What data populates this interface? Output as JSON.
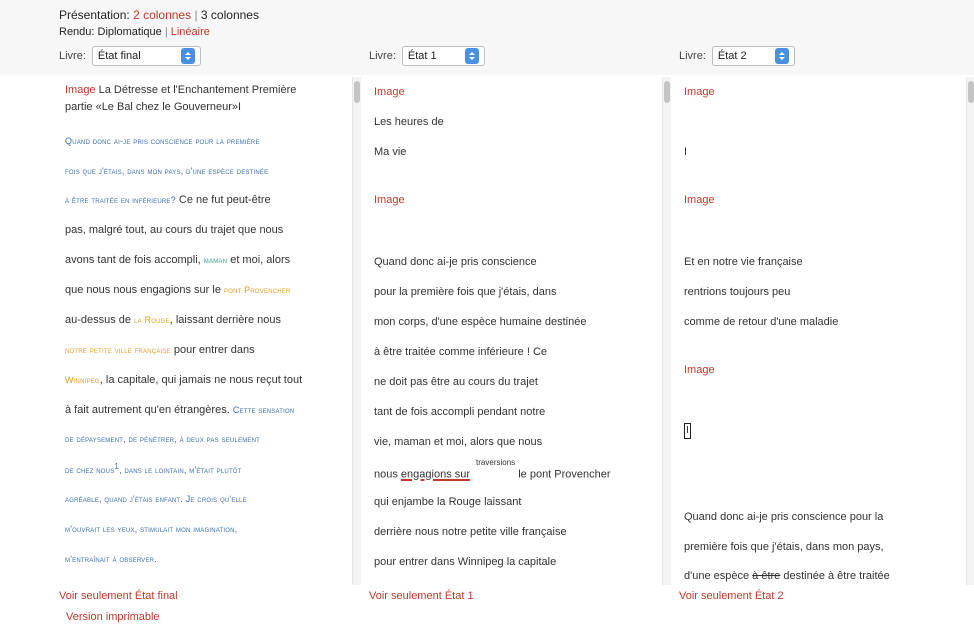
{
  "header": {
    "presentation_label": "Présentation:",
    "presentation_opt1": "2 colonnes",
    "presentation_sep": "|",
    "presentation_opt2": "3 colonnes",
    "rendu_label": "Rendu:",
    "rendu_opt1": "Diplomatique",
    "rendu_sep": "|",
    "rendu_opt2": "Linéaire"
  },
  "selectors": [
    {
      "label": "Livre:",
      "value": "État final"
    },
    {
      "label": "Livre:",
      "value": "État 1"
    },
    {
      "label": "Livre:",
      "value": "État 2"
    }
  ],
  "col1": {
    "l1_img": "Image",
    "l1_text": " La Détresse et l'Enchantement Première",
    "l2": "partie «Le Bal chez le Gouverneur»I",
    "l3": "Quand donc ai-je pris conscience pour la première",
    "l4": "fois que j'étais, dans mon pays, d'une espèce destinée",
    "l5_sc": "à être traitée en inférieure?",
    "l5_text": " Ce ne fut peut-être",
    "l6": "pas, malgré tout, au cours du trajet que nous",
    "l7_a": "avons tant de fois accompli, ",
    "l7_sc": "maman",
    "l7_b": " et moi, alors",
    "l8_a": "que nous nous engagions sur le ",
    "l8_sc": "pont Provencher",
    "l9_a": "au-dessus de ",
    "l9_sc": "la Rouge",
    "l9_b": ", laissant derrière nous",
    "l10_sc": "notre petite ville française",
    "l10_b": " pour entrer dans",
    "l11_sc": "Winnipeg",
    "l11_b": ", la capitale, qui jamais ne nous reçut tout",
    "l12_a": "à fait autrement qu'en étrangères. ",
    "l12_sc": "Cette sensation",
    "l13": "de dépaysement, de pénétrer, à deux pas seulement",
    "l14_a": "de chez nous",
    "l14_sup": "1",
    "l14_b": ", dans le lointain, m'était plutôt",
    "l15": "agréable, quand j'étais enfant. Je crois qu'elle",
    "l16": "m'ouvrait les yeux, stimulait mon imagination,",
    "l17": "m'entraînait à observer."
  },
  "col2": {
    "l1": "Image",
    "l2": "Les heures de",
    "l3": "Ma vie",
    "l4": "Image",
    "l5": "Quand donc ai-je pris conscience",
    "l6": "pour la première fois que j'étais, dans",
    "l7": "mon corps, d'une espèce humaine destinée",
    "l8": "à être traitée comme inférieure ! Ce",
    "l9": "ne doit pas être au cours du trajet",
    "l10": "tant de fois accompli pendant notre",
    "l11": "vie, maman et moi, alors que nous",
    "l12_a": "nous ",
    "l12_u": "engagions sur",
    "l12_sup": "traversions",
    "l12_b": " le pont Provencher",
    "l13": "qui enjambe la Rouge laissant",
    "l14": "derrière nous notre petite ville française",
    "l15": "pour entrer dans Winnipeg la capitale"
  },
  "col3": {
    "l1": "Image",
    "l2": "I",
    "l3": "Image",
    "l4": "Et en notre vie française",
    "l5": "rentrions toujours peu",
    "l6": "comme de retour d'une maladie",
    "l7": "Image",
    "l8": "I",
    "l9": "Quand donc ai-je pris conscience pour la",
    "l10": "première fois que j'étais, dans mon pays,",
    "l11_a": "d'une espèce ",
    "l11_s": "à être",
    "l11_b": " destinée à être traitée"
  },
  "footer": {
    "voir1": "Voir seulement État final",
    "voir2": "Voir seulement État 1",
    "voir3": "Voir seulement État 2",
    "version": "Version imprimable"
  }
}
